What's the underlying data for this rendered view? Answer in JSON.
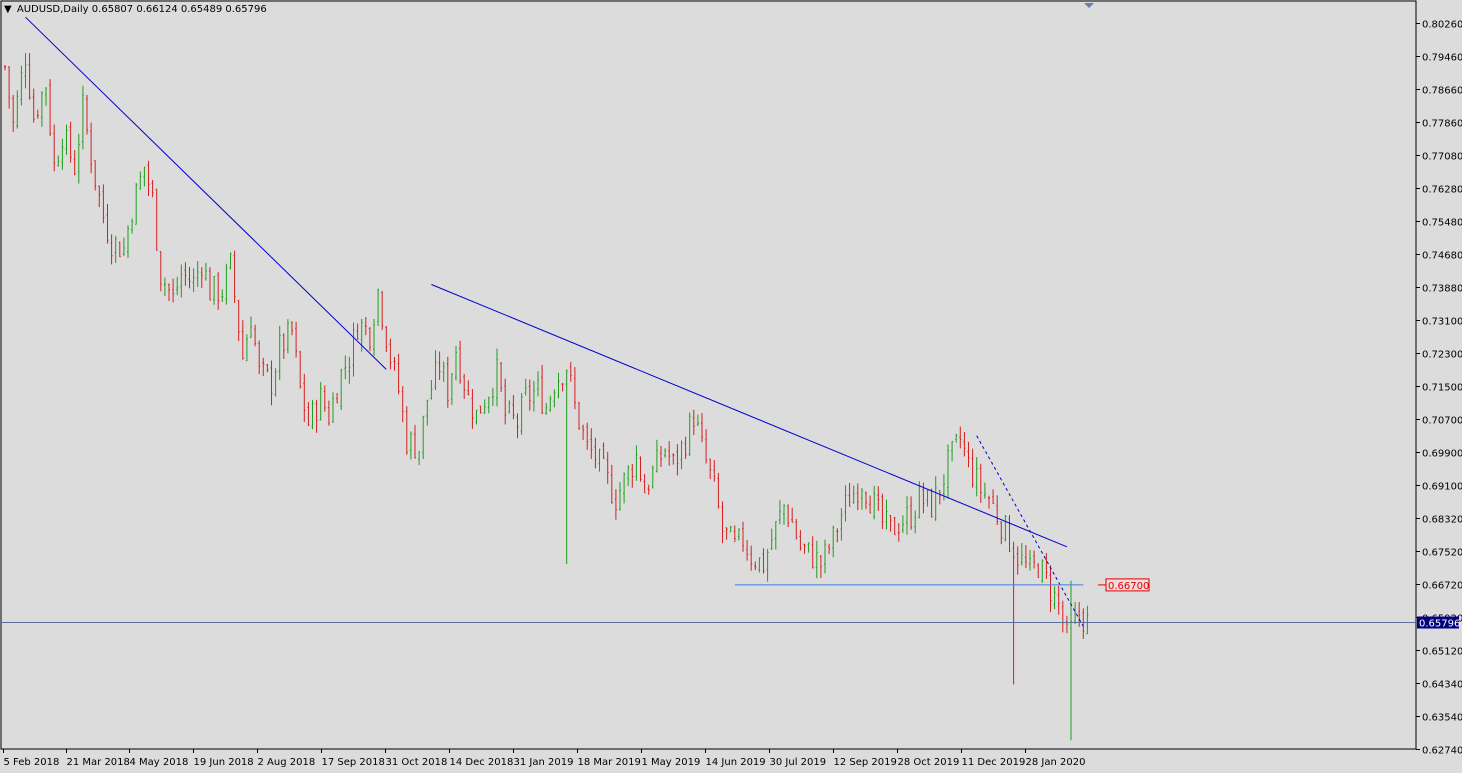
{
  "header": {
    "symbol_timeframe": "AUDUSD,Daily",
    "ohlc": "0.65807 0.66124 0.65489 0.65796"
  },
  "colors": {
    "background": "#dcdcdc",
    "bull": "#1f9e1f",
    "bear": "#d42020",
    "trendline": "#0000cd",
    "support": "#3a7fe0",
    "current_price_line": "#5a6f9a",
    "price_box_fill": "#000080",
    "label_box": "#e00000",
    "axis": "#000000"
  },
  "chart_data": {
    "type": "candlestick",
    "symbol": "AUDUSD",
    "timeframe": "Daily",
    "y_ticks": [
      "0.80260",
      "0.79460",
      "0.78660",
      "0.77860",
      "0.77080",
      "0.76280",
      "0.75480",
      "0.74680",
      "0.73880",
      "0.73100",
      "0.72300",
      "0.71500",
      "0.70700",
      "0.69900",
      "0.69100",
      "0.68320",
      "0.67520",
      "0.66720",
      "0.65920",
      "0.65120",
      "0.64340",
      "0.63540",
      "0.62740"
    ],
    "x_ticks": [
      "5 Feb 2018",
      "21 Mar 2018",
      "4 May 2018",
      "19 Jun 2018",
      "2 Aug 2018",
      "17 Sep 2018",
      "31 Oct 2018",
      "14 Dec 2018",
      "31 Jan 2019",
      "18 Mar 2019",
      "1 May 2019",
      "14 Jun 2019",
      "30 Jul 2019",
      "12 Sep 2019",
      "28 Oct 2019",
      "11 Dec 2019",
      "28 Jan 2020"
    ],
    "ylim": [
      0.6234,
      0.8066
    ],
    "anchors": [
      [
        0,
        0.792
      ],
      [
        2,
        0.778
      ],
      [
        4,
        0.795
      ],
      [
        6,
        0.78
      ],
      [
        8,
        0.788
      ],
      [
        10,
        0.768
      ],
      [
        12,
        0.776
      ],
      [
        14,
        0.768
      ],
      [
        16,
        0.782
      ],
      [
        18,
        0.765
      ],
      [
        20,
        0.756
      ],
      [
        22,
        0.75
      ],
      [
        24,
        0.748
      ],
      [
        26,
        0.758
      ],
      [
        28,
        0.768
      ],
      [
        30,
        0.76
      ],
      [
        32,
        0.742
      ],
      [
        34,
        0.736
      ],
      [
        36,
        0.742
      ],
      [
        38,
        0.74
      ],
      [
        40,
        0.745
      ],
      [
        42,
        0.738
      ],
      [
        44,
        0.738
      ],
      [
        46,
        0.744
      ],
      [
        48,
        0.722
      ],
      [
        50,
        0.732
      ],
      [
        52,
        0.718
      ],
      [
        54,
        0.716
      ],
      [
        56,
        0.724
      ],
      [
        58,
        0.728
      ],
      [
        60,
        0.714
      ],
      [
        62,
        0.706
      ],
      [
        64,
        0.712
      ],
      [
        66,
        0.708
      ],
      [
        68,
        0.718
      ],
      [
        70,
        0.722
      ],
      [
        72,
        0.73
      ],
      [
        74,
        0.728
      ],
      [
        76,
        0.738
      ],
      [
        78,
        0.722
      ],
      [
        80,
        0.714
      ],
      [
        82,
        0.702
      ],
      [
        84,
        0.7
      ],
      [
        86,
        0.712
      ],
      [
        88,
        0.72
      ],
      [
        90,
        0.714
      ],
      [
        92,
        0.724
      ],
      [
        94,
        0.712
      ],
      [
        96,
        0.708
      ],
      [
        98,
        0.714
      ],
      [
        100,
        0.718
      ],
      [
        102,
        0.708
      ],
      [
        104,
        0.706
      ],
      [
        106,
        0.712
      ],
      [
        108,
        0.714
      ],
      [
        110,
        0.71
      ],
      [
        112,
        0.716
      ],
      [
        114,
        0.72
      ],
      [
        116,
        0.71
      ],
      [
        118,
        0.7
      ],
      [
        120,
        0.698
      ],
      [
        122,
        0.694
      ],
      [
        124,
        0.688
      ],
      [
        126,
        0.692
      ],
      [
        128,
        0.698
      ],
      [
        130,
        0.69
      ],
      [
        132,
        0.694
      ],
      [
        134,
        0.7
      ],
      [
        136,
        0.696
      ],
      [
        138,
        0.702
      ],
      [
        140,
        0.708
      ],
      [
        142,
        0.7
      ],
      [
        144,
        0.69
      ],
      [
        146,
        0.68
      ],
      [
        148,
        0.676
      ],
      [
        150,
        0.678
      ],
      [
        152,
        0.674
      ],
      [
        154,
        0.672
      ],
      [
        156,
        0.678
      ],
      [
        158,
        0.686
      ],
      [
        160,
        0.682
      ],
      [
        162,
        0.676
      ],
      [
        164,
        0.674
      ],
      [
        166,
        0.672
      ],
      [
        168,
        0.678
      ],
      [
        170,
        0.684
      ],
      [
        172,
        0.688
      ],
      [
        174,
        0.692
      ],
      [
        176,
        0.688
      ],
      [
        178,
        0.682
      ],
      [
        180,
        0.68
      ],
      [
        182,
        0.682
      ],
      [
        184,
        0.684
      ],
      [
        186,
        0.688
      ],
      [
        188,
        0.686
      ],
      [
        190,
        0.69
      ],
      [
        192,
        0.696
      ],
      [
        194,
        0.702
      ],
      [
        196,
        0.696
      ],
      [
        198,
        0.69
      ],
      [
        200,
        0.688
      ],
      [
        202,
        0.684
      ],
      [
        204,
        0.678
      ],
      [
        206,
        0.674
      ],
      [
        208,
        0.67
      ],
      [
        210,
        0.672
      ],
      [
        212,
        0.668
      ],
      [
        214,
        0.662
      ],
      [
        216,
        0.654
      ],
      [
        218,
        0.66
      ],
      [
        220,
        0.658
      ]
    ],
    "overrides": {
      "114": {
        "l": 0.672
      },
      "205": {
        "l": 0.643
      },
      "217": {
        "h": 0.668,
        "l": 0.6295
      }
    },
    "lines": [
      {
        "kind": "trend",
        "i1": 5,
        "p1": 0.804,
        "i2": 93,
        "p2": 0.719
      },
      {
        "kind": "trend",
        "i1": 104,
        "p1": 0.7395,
        "i2": 259,
        "p2": 0.6762
      },
      {
        "kind": "trend_dashed",
        "i1": 237,
        "p1": 0.703,
        "i2": 263,
        "p2": 0.657
      },
      {
        "kind": "support",
        "i1": 178,
        "p1": 0.667,
        "i2": 263,
        "p2": 0.667
      }
    ],
    "price_label": "0.66700",
    "current_price": "0.65796",
    "current_price_value": 0.65796
  }
}
